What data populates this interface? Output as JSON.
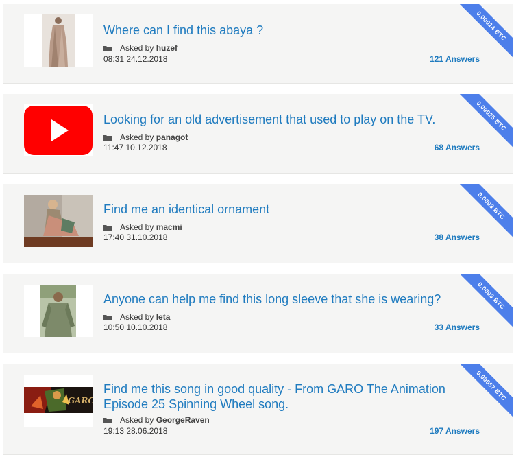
{
  "questions": [
    {
      "title": "Where can I find this abaya ?",
      "asked_by_label": "Asked by",
      "user": "huzef",
      "time": "08:31 24.12.2018",
      "answers": "121 Answers",
      "reward": "0.00014 BTC",
      "thumb": "abaya-photo"
    },
    {
      "title": "Looking for an old advertisement that used to play on the TV.",
      "asked_by_label": "Asked by",
      "user": "panagot",
      "time": "11:47 10.12.2018",
      "answers": "68 Answers",
      "reward": "0.00025 BTC",
      "thumb": "youtube-logo"
    },
    {
      "title": "Find me an identical ornament",
      "asked_by_label": "Asked by",
      "user": "macmi",
      "time": "17:40 31.10.2018",
      "answers": "38 Answers",
      "reward": "0.0003 BTC",
      "thumb": "ornament-photo"
    },
    {
      "title": "Anyone can help me find this long sleeve that she is wearing?",
      "asked_by_label": "Asked by",
      "user": "leta",
      "time": "10:50 10.10.2018",
      "answers": "33 Answers",
      "reward": "0.0003 BTC",
      "thumb": "long-sleeve-photo"
    },
    {
      "title": "Find me this song in good quality - From GARO The Animation Episode 25 Spinning Wheel song.",
      "asked_by_label": "Asked by",
      "user": "GeorgeRaven",
      "time": "19:13 28.06.2018",
      "answers": "197 Answers",
      "reward": "0.00057 BTC",
      "thumb": "garo-anime-banner",
      "thumb_text": "GARO"
    }
  ],
  "colors": {
    "link": "#1f7bbf",
    "ribbon": "#4d7fea",
    "card_bg": "#f5f5f4",
    "youtube_red": "#ff0000"
  }
}
